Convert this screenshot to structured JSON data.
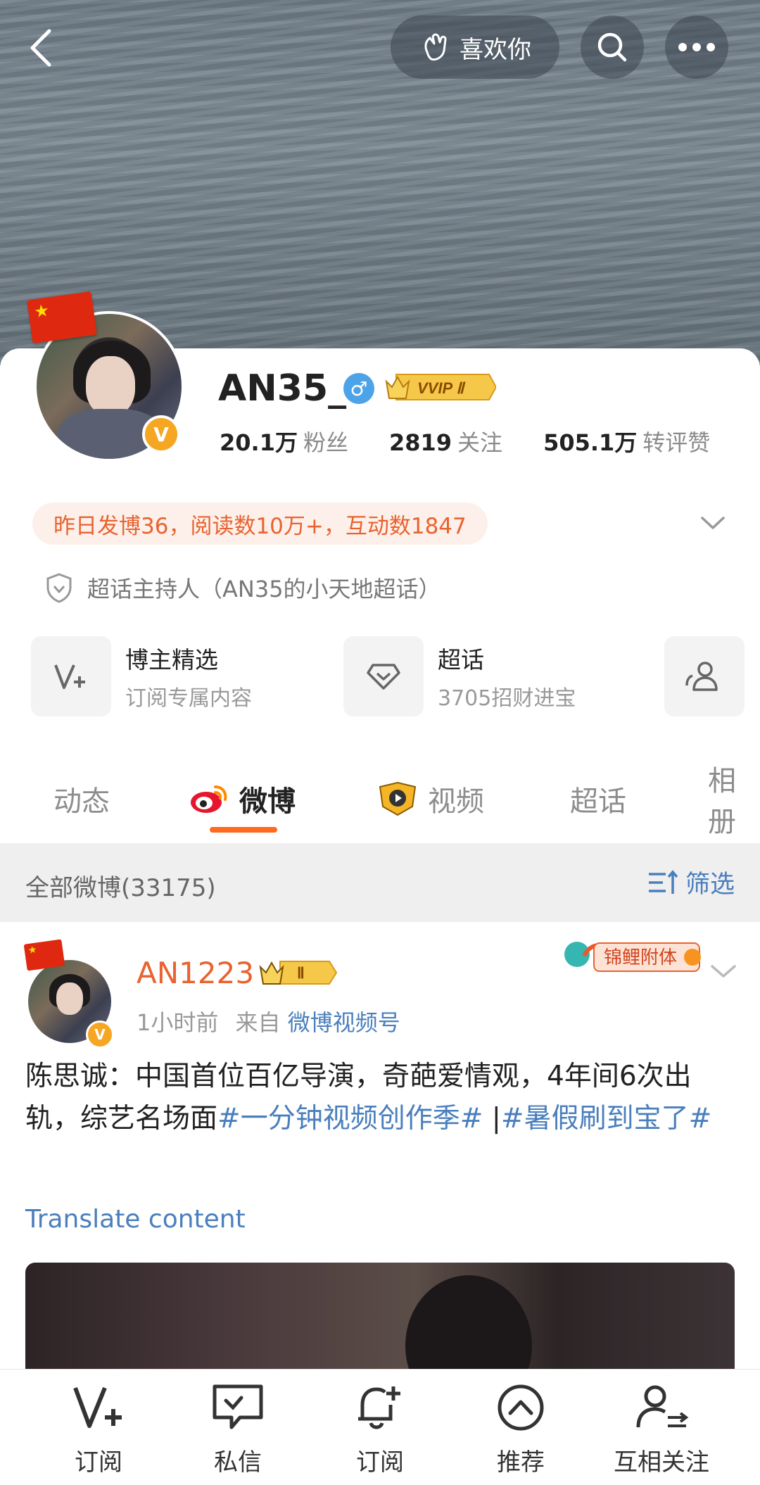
{
  "header": {
    "like_label": "喜欢你"
  },
  "profile": {
    "username": "AN35_",
    "vip_badge": "VVIP Ⅱ",
    "stats": [
      {
        "value": "20.1万",
        "label": "粉丝"
      },
      {
        "value": "2819",
        "label": "关注"
      },
      {
        "value": "505.1万",
        "label": "转评赞"
      }
    ],
    "summary": "昨日发博36，阅读数10万+，互动数1847",
    "host_role": "超话主持人（AN35的小天地超话）"
  },
  "shortcuts": [
    {
      "title": "博主精选",
      "subtitle": "订阅专属内容",
      "icon": "v-plus-icon"
    },
    {
      "title": "超话",
      "subtitle": "3705招财进宝",
      "icon": "diamond-icon"
    },
    {
      "title": "",
      "subtitle": "",
      "icon": "group-icon"
    }
  ],
  "tabs": [
    {
      "label": "动态"
    },
    {
      "label": "微博",
      "active": true
    },
    {
      "label": "视频"
    },
    {
      "label": "超话"
    },
    {
      "label": "相册"
    }
  ],
  "feed": {
    "all_label": "全部微博(33175)",
    "filter_label": "筛选"
  },
  "post": {
    "author": "AN1223",
    "crown_badge": "Ⅱ",
    "time": "1小时前",
    "from_prefix": "来自",
    "source": "微博视频号",
    "koi_badge": "锦鲤附体",
    "text_plain": "陈思诚：中国首位百亿导演，奇葩爱情观，4年间6次出轨，综艺名场面",
    "tag1": "#一分钟视频创作季#",
    "separator": " |",
    "tag2": "#暑假刷到宝了#",
    "translate": "Translate content"
  },
  "bottom_nav": [
    {
      "label": "订阅",
      "icon": "v-plus-icon"
    },
    {
      "label": "私信",
      "icon": "chat-icon"
    },
    {
      "label": "订阅",
      "icon": "bell-plus-icon"
    },
    {
      "label": "推荐",
      "icon": "up-arrow-circle-icon"
    },
    {
      "label": "互相关注",
      "icon": "mutual-follow-icon"
    }
  ],
  "colors": {
    "accent": "#e8632f",
    "link": "#4a7fbd",
    "tab_underline": "#ff6a1f"
  }
}
